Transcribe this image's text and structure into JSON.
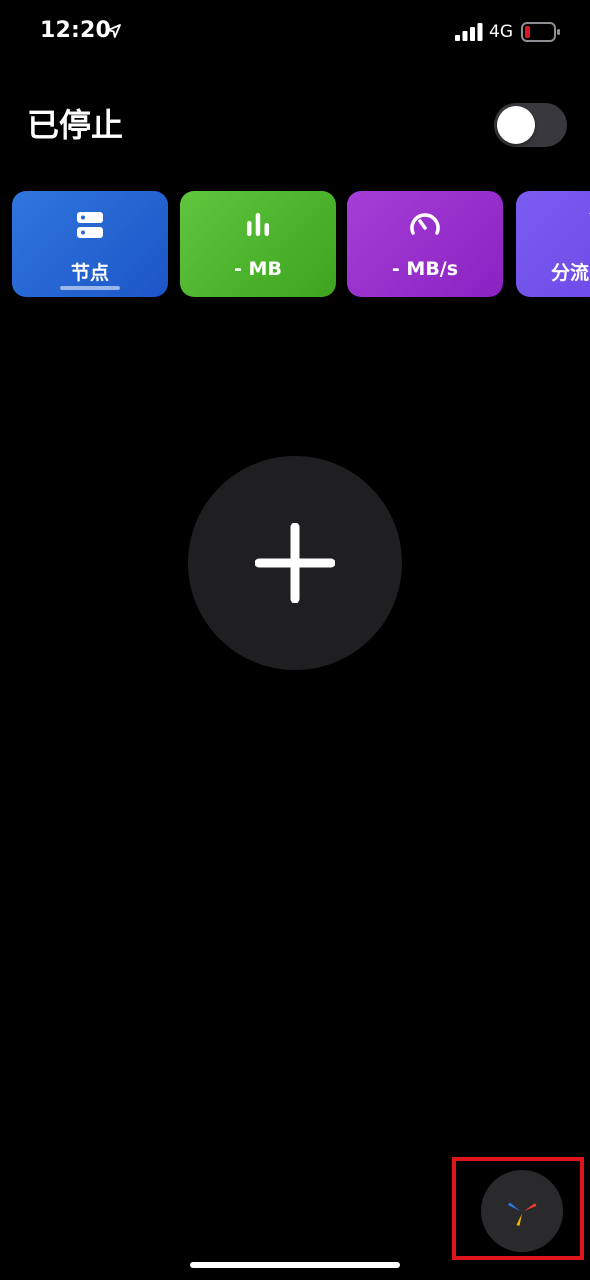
{
  "status_bar": {
    "time": "12:20",
    "network": "4G",
    "location_icon": "location-arrow-icon",
    "signal_icon": "cellular-signal-icon",
    "battery_icon": "battery-low-icon",
    "battery_color": "#e0151b"
  },
  "header": {
    "title": "已停止",
    "toggle_state": "off"
  },
  "cards": [
    {
      "label": "节点",
      "icon": "server-icon",
      "color": "#2f76dd",
      "selected": true
    },
    {
      "label": "- MB",
      "icon": "bar-chart-icon",
      "color": "#5fc63e"
    },
    {
      "label": "- MB/s",
      "icon": "speedometer-icon",
      "color": "#a53ed6"
    },
    {
      "label": "分流",
      "icon": "filter-icon",
      "color": "#7b5cf0"
    }
  ],
  "main": {
    "add_icon": "plus-icon"
  },
  "assistant": {
    "icon": "pinwheel-logo-icon",
    "highlight_color": "#e0151b"
  }
}
